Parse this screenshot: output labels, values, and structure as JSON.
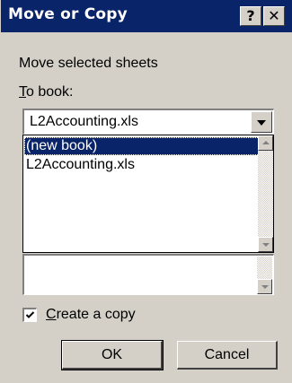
{
  "window": {
    "title": "Move or Copy",
    "help_button": "?",
    "close_button": "✕"
  },
  "labels": {
    "move_selected": "Move selected sheets",
    "to_book_accel": "T",
    "to_book_rest": "o book:"
  },
  "to_book": {
    "value": "L2Accounting.xls",
    "options": [
      "(new book)",
      "L2Accounting.xls"
    ],
    "selected_index": 0
  },
  "create_copy": {
    "checked": true,
    "accel": "C",
    "rest": "reate a copy"
  },
  "buttons": {
    "ok": "OK",
    "cancel": "Cancel"
  },
  "colors": {
    "titlebar": "#0a246a",
    "face": "#d4d0c8",
    "selection": "#0a246a"
  }
}
